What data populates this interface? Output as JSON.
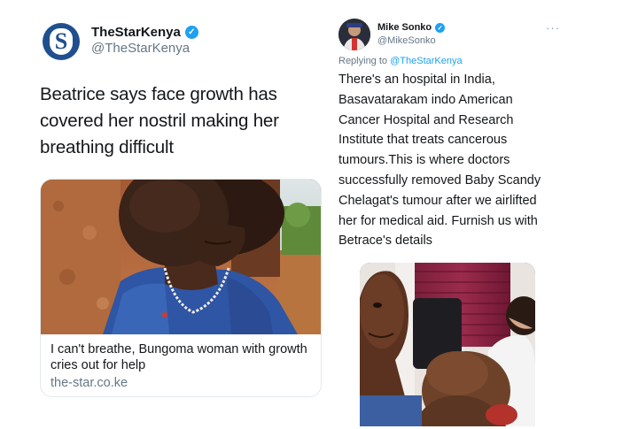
{
  "left_tweet": {
    "display_name": "TheStarKenya",
    "handle": "@TheStarKenya",
    "avatar_letter": "S",
    "text": "Beatrice says face growth has covered her nostril making her breathing difficult",
    "card": {
      "title": "I can't breathe, Bungoma woman with growth cries out for help",
      "domain": "the-star.co.ke"
    }
  },
  "right_tweet": {
    "display_name": "Mike Sonko",
    "handle": "@MikeSonko",
    "more_icon": "···",
    "reply_prefix": "Replying to",
    "reply_mention": "@TheStarKenya",
    "text": "There's an hospital in India, Basavatarakam indo American Cancer Hospital and Research Institute that treats cancerous tumours.This is where doctors successfully removed Baby Scandy Chelagat's tumour after we airlifted her for medical aid. Furnish us with Betrace's details"
  },
  "icons": {
    "verified": "verified-badge-icon",
    "more": "more-options-icon"
  },
  "colors": {
    "twitter_blue": "#1da1f2",
    "secondary_text": "#657786",
    "star_logo_blue": "#1f4f8f"
  }
}
